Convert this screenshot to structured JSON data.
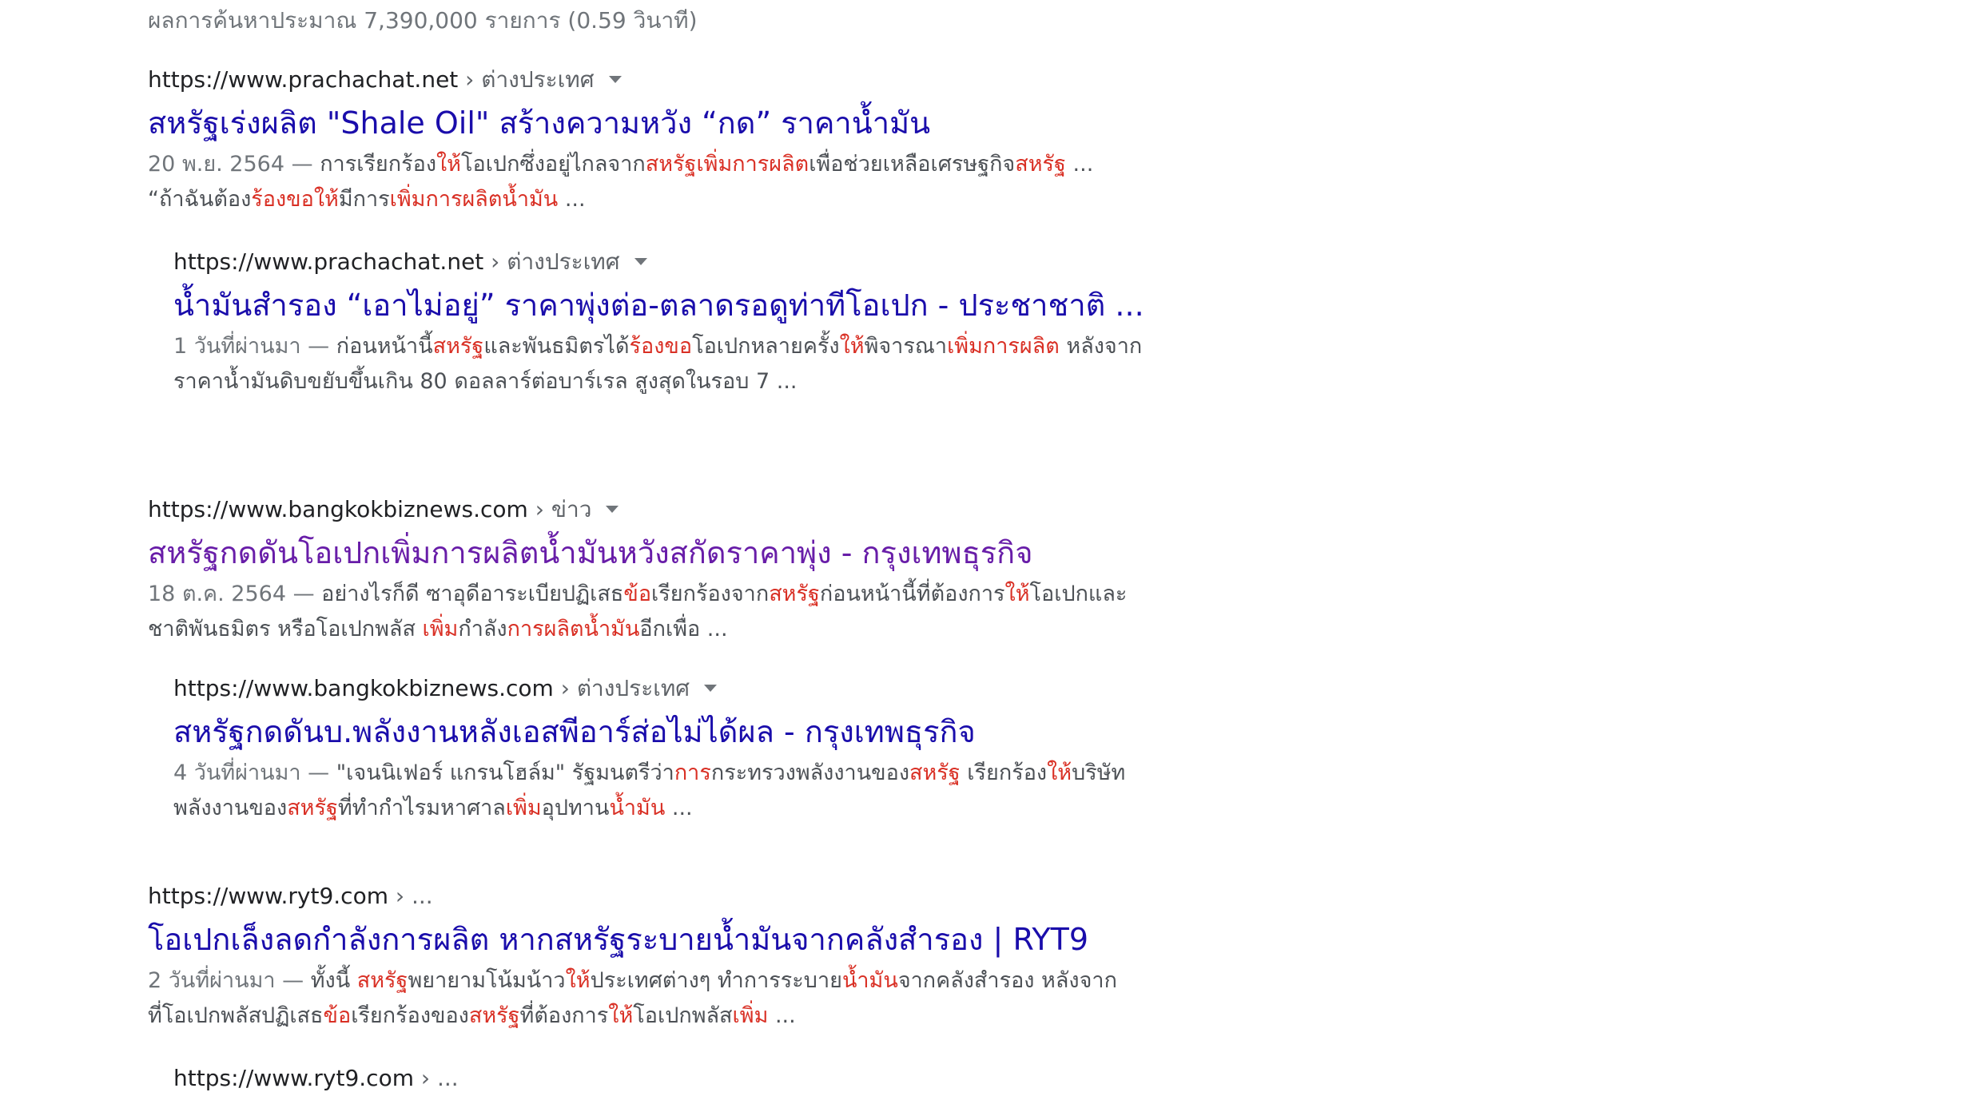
{
  "stats": "ผลการค้นหาประมาณ 7,390,000 รายการ (0.59 วินาที)",
  "results": [
    {
      "url": "https://www.prachachat.net",
      "crumb": " › ต่างประเทศ",
      "title": "สหรัฐเร่งผลิต \"Shale Oil\" สร้างความหวัง “กด” ราคาน้ำมัน",
      "visited": false,
      "date": "20 พ.ย. 2564 — ",
      "snippet": [
        [
          "การเรียกร้อง",
          0
        ],
        [
          "ให้",
          1
        ],
        [
          "โอเปกซึ่งอยู่ไกลจาก",
          0
        ],
        [
          "สหรัฐเพิ่มการผลิต",
          1
        ],
        [
          "เพื่อช่วยเหลือเศรษฐกิจ",
          0
        ],
        [
          "สหรัฐ",
          1
        ],
        [
          " ... ",
          0
        ],
        [
          "“ถ้าฉันต้อง",
          0
        ],
        [
          "ร้องขอให้",
          1
        ],
        [
          "มีการ",
          0
        ],
        [
          "เพิ่มการผลิตน้ำมัน",
          1
        ],
        [
          " ...",
          0
        ]
      ]
    },
    {
      "url": "https://www.prachachat.net",
      "crumb": " › ต่างประเทศ",
      "title": "น้ำมันสำรอง “เอาไม่อยู่” ราคาพุ่งต่อ-ตลาดรอดูท่าทีโอเปก - ประชาชาติ ...",
      "visited": false,
      "date": "1 วันที่ผ่านมา — ",
      "snippet": [
        [
          "ก่อนหน้านี้",
          0
        ],
        [
          "สหรัฐ",
          1
        ],
        [
          "และพันธมิตรได้",
          0
        ],
        [
          "ร้องขอ",
          1
        ],
        [
          "โอเปกหลายครั้ง",
          0
        ],
        [
          "ให้",
          1
        ],
        [
          "พิจารณา",
          0
        ],
        [
          "เพิ่มการผลิต",
          1
        ],
        [
          " หลังจากราคาน้ำมันดิบขยับขึ้นเกิน 80 ดอลลาร์ต่อบาร์เรล สูงสุดในรอบ 7 ...",
          0
        ]
      ]
    },
    {
      "url": "https://www.bangkokbiznews.com",
      "crumb": " › ข่าว",
      "title": "สหรัฐกดดันโอเปกเพิ่มการผลิตน้ำมันหวังสกัดราคาพุ่ง - กรุงเทพธุรกิจ",
      "visited": true,
      "date": "18 ต.ค. 2564 — ",
      "snippet": [
        [
          "อย่างไรก็ดี ซาอุดีอาระเบียปฏิเสธ",
          0
        ],
        [
          "ข้อ",
          1
        ],
        [
          "เรียกร้องจาก",
          0
        ],
        [
          "สหรัฐ",
          1
        ],
        [
          "ก่อนหน้านี้ที่ต้องการ",
          0
        ],
        [
          "ให้",
          1
        ],
        [
          "โอเปกและชาติพันธมิตร หรือโอเปกพลัส ",
          0
        ],
        [
          "เพิ่ม",
          1
        ],
        [
          "กำลัง",
          0
        ],
        [
          "การผลิตน้ำมัน",
          1
        ],
        [
          "อีกเพื่อ ...",
          0
        ]
      ]
    },
    {
      "url": "https://www.bangkokbiznews.com",
      "crumb": " › ต่างประเทศ",
      "title": "สหรัฐกดดันบ.พลังงานหลังเอสพีอาร์ส่อไม่ได้ผล - กรุงเทพธุรกิจ",
      "visited": false,
      "date": "4 วันที่ผ่านมา — ",
      "snippet": [
        [
          "\"เจนนิเฟอร์ แกรนโฮล์ม\" รัฐมนตรีว่า",
          0
        ],
        [
          "การ",
          1
        ],
        [
          "กระทรวงพลังงานของ",
          0
        ],
        [
          "สหรัฐ",
          1
        ],
        [
          " เรียกร้อง",
          0
        ],
        [
          "ให้",
          1
        ],
        [
          "บริษัทพลังงานของ",
          0
        ],
        [
          "สหรัฐ",
          1
        ],
        [
          "ที่ทำกำไรมหาศาล",
          0
        ],
        [
          "เพิ่ม",
          1
        ],
        [
          "อุปทาน",
          0
        ],
        [
          "น้ำมัน",
          1
        ],
        [
          " ...",
          0
        ]
      ]
    },
    {
      "url": "https://www.ryt9.com",
      "crumb": " › ...",
      "title": "โอเปกเล็งลดกำลังการผลิต หากสหรัฐระบายน้ำมันจากคลังสำรอง | RYT9",
      "visited": false,
      "date": "2 วันที่ผ่านมา — ",
      "snippet": [
        [
          "ทั้งนี้ ",
          0
        ],
        [
          "สหรัฐ",
          1
        ],
        [
          "พยายามโน้มน้าว",
          0
        ],
        [
          "ให้",
          1
        ],
        [
          "ประเทศต่างๆ ทำการระบาย",
          0
        ],
        [
          "น้ำมัน",
          1
        ],
        [
          "จากคลังสำรอง หลังจากที่โอเปกพลัสปฏิเสธ",
          0
        ],
        [
          "ข้อ",
          1
        ],
        [
          "เรียกร้องของ",
          0
        ],
        [
          "สหรัฐ",
          1
        ],
        [
          "ที่ต้องการ",
          0
        ],
        [
          "ให้",
          1
        ],
        [
          "โอเปกพลัส",
          0
        ],
        [
          "เพิ่ม",
          1
        ],
        [
          " ...",
          0
        ]
      ]
    },
    {
      "url": "https://www.ryt9.com",
      "crumb": " › ..."
    }
  ]
}
